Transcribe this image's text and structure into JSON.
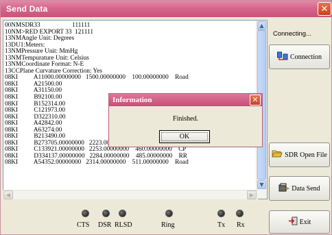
{
  "window": {
    "title": "Send Data"
  },
  "log_lines": [
    "00NMSDR33                    111111",
    "10NM>RED EXPORT 33  121111",
    "13NMAngle Unit: Degrees",
    "13DU1:Meters:",
    "13NMPressure Unit: MmHg",
    "13NMTempurature Unit: Celsius",
    "13NMCoordinate Format: N-E",
    "13CCPlane Curvature Correction: Yes",
    "08KI          A11000.00000000   1500.00000000    100.00000000    Road",
    "08KI          A21500.00",
    "08KI          A31150.00",
    "08KI          B92100.00",
    "08KI          B152314.00",
    "08KI          C121973.00",
    "08KI          D322310.00",
    "08KI          A42842.00",
    "08KI          A63274.00",
    "08KI          B213490.00",
    "08KI          B273705.00000000   2223.00000000    435.00000000    Road",
    "08KI          C133921.00000000   2253.00000000    460.00000000    CP",
    "08KI          D334137.00000000   2284.00000000    485.00000000    RR",
    "08KI          A54352.00000000   2314.00000000    511.00000000    Road"
  ],
  "sidebar": {
    "status": "Connecting...",
    "connection_label": "Connection",
    "sdr_open_label": "SDR Open File",
    "data_send_label": "Data Send",
    "exit_label": "Exit"
  },
  "signals": [
    {
      "label": "CTS"
    },
    {
      "label": "DSR"
    },
    {
      "label": "RLSD"
    },
    {
      "label": "Ring"
    },
    {
      "label": "Tx"
    },
    {
      "label": "Rx"
    }
  ],
  "dialog": {
    "title": "Information",
    "message": "Finished.",
    "ok_label": "OK"
  },
  "icons": {
    "close": "close-icon",
    "connection": "connection-icon",
    "folder": "folder-open-icon",
    "send": "data-send-icon",
    "exit": "exit-icon"
  },
  "colors": {
    "title_bar": "#d8668c",
    "dialog_title": "#c84d78",
    "window_bg": "#ece9d8",
    "close_button": "#d9562f"
  }
}
